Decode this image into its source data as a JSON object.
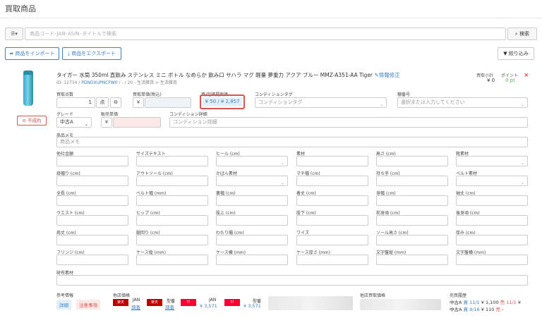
{
  "header": {
    "title": "買取商品"
  },
  "search": {
    "filter_label": "☰▾",
    "placeholder": "商品コード･JAN･ASIN･タイトルで検索",
    "button_label": "検索"
  },
  "toolbar": {
    "import_label": "商品をインポート",
    "export_label": "商品をエクスポート",
    "narrow_label": "絞り込み"
  },
  "product": {
    "title": "タイガー 水筒 350ml 直飲み ステンレス ミニ ボトル なめらか 飲み口 サハラ マグ 軽量 夢重力 アクア ブルー MMZ-A351-AA Tiger",
    "edit_label": "情報修正",
    "meta_prefix": "ID: 12734 /",
    "meta_code": "PDNDXUPNCFW0",
    "meta_suffix": "/ - / 20 - 生活雑貨 > 生活雑貨",
    "total_label": "買取小計",
    "total_value": "¥ 0",
    "point_label": "ポイント",
    "point_value": "0 pt",
    "ng_label": "不成約"
  },
  "fields": {
    "qty_label": "買取点数",
    "qty_value": "1",
    "qty_unit": "点",
    "unit_price_label": "買取単価(税込)",
    "unit_price_prefix": "¥",
    "ref_price_label": "買/定価提案価",
    "ref_price_value": "¥ 50 / ¥ 2,857",
    "condition_tag_label": "コンディションタグ",
    "condition_tag_placeholder": "コンディションタグ",
    "shelf_label": "棚番号",
    "shelf_placeholder": "選択または入力してください",
    "grade_label": "グレード",
    "grade_value": "中古A",
    "sale_price_label": "販売単価",
    "sale_price_prefix": "¥",
    "condition_detail_label": "コンディション詳細",
    "condition_detail_placeholder": "コンディション詳細",
    "memo_label": "商品メモ",
    "memo_placeholder": "商品メモ"
  },
  "attributes": [
    [
      "他社金額",
      "サイズテキスト",
      "ヒール (cm)",
      "素材",
      "高さ (cm)",
      "靴素材"
    ],
    [
      "肩幅り (cm)",
      "アウトソール (cm)",
      "かばん素材",
      "マチ幅 (cm)",
      "持ち手 (cm)",
      "ベルト素材"
    ],
    [
      "全長 (cm)",
      "ベルト幅 (mm)",
      "裏幅 (cm)",
      "着丈 (cm)",
      "身幅 (cm)",
      "袖丈 (cm)"
    ],
    [
      "ウエスト (cm)",
      "ヒップ (cm)",
      "股上 (cm)",
      "股下 (cm)",
      "前身頃 (cm)",
      "後身頃 (cm)"
    ],
    [
      "肩丈 (cm)",
      "腿回り (cm)",
      "わたり幅 (cm)",
      "ワイズ",
      "ソール高さ (cm)",
      "厚み (cm)"
    ],
    [
      "フリンジ (cm)",
      "ケース縦 (mm)",
      "ケース横 (mm)",
      "ケース厚さ (mm)",
      "文字盤縦 (mm)",
      "文字盤横 (mm)"
    ]
  ],
  "wallet_label": "財布素材",
  "bottom": {
    "ref_label": "参考情報",
    "detail_label": "詳細",
    "caution_label": "注意事項",
    "other_price_label": "他店価格",
    "other_buy_label": "他店買取価格",
    "sales_history_label": "売買履歴",
    "rakuten_jan": "JAN",
    "rakuten_jan_link": "調査",
    "rakuten_shiraku": "型番",
    "rakuten_shiraku_link": "調査",
    "yahoo1_label": "JAN",
    "yahoo1_price": "¥ 3,571",
    "yahoo2_label": "型番",
    "yahoo2_price": "¥ 3,571",
    "hist1": "中古A",
    "hist1_buy": "買 11/1",
    "hist1_buy_price": "¥ 1,100",
    "hist1_sell": "売 11/1",
    "hist1_sell_price": "¥",
    "hist2": "中古A",
    "hist2_buy": "買 9/16",
    "hist2_buy_price": "¥ 110",
    "hist2_sell": "売",
    "hist2_sell_price": "-"
  },
  "colors": {
    "accent": "#3b7fc4",
    "danger": "#d9534f",
    "success": "#5cb85c"
  }
}
